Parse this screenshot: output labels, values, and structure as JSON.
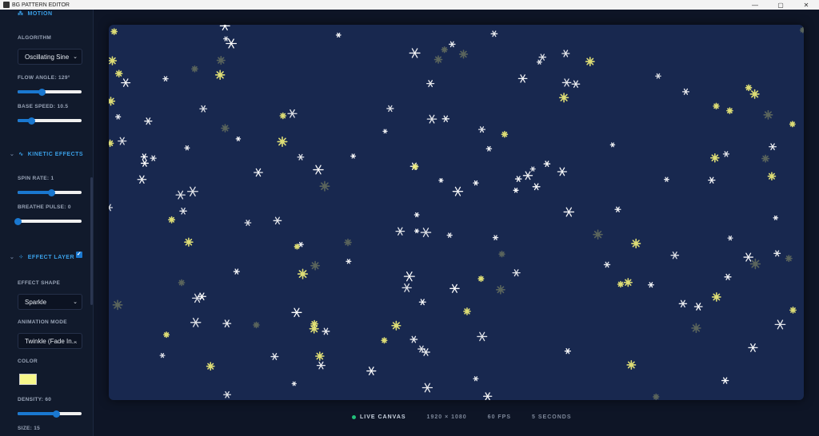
{
  "window": {
    "title": "BG PATTERN EDITOR",
    "controls": [
      "—",
      "▢",
      "✕"
    ]
  },
  "sidebar": {
    "motion": {
      "title": "MOTION",
      "algorithm_label": "ALGORITHM",
      "algorithm_value": "Oscillating Sine",
      "flow_angle_label": "FLOW ANGLE: 129°",
      "flow_angle": 129,
      "flow_angle_fraction": 0.37,
      "base_speed_label": "BASE SPEED: 10.5",
      "base_speed": 10.5,
      "base_speed_fraction": 0.21
    },
    "kinetic": {
      "title": "KINETIC EFFECTS",
      "spin_label": "SPIN RATE: 1",
      "spin_fraction": 0.53,
      "breathe_label": "BREATHE PULSE: 0",
      "breathe_fraction": 0.0
    },
    "effect": {
      "title": "EFFECT LAYER",
      "enabled": true,
      "shape_label": "EFFECT SHAPE",
      "shape_value": "Sparkle",
      "mode_label": "ANIMATION MODE",
      "mode_value": "Twinkle (Fade In...",
      "color_label": "COLOR",
      "color": "#f7f78a",
      "density_label": "DENSITY: 60",
      "density_fraction": 0.6,
      "size_label": "SIZE: 15"
    }
  },
  "status": {
    "live": "LIVE CANVAS",
    "resolution": "1920 × 1080",
    "fps": "60 FPS",
    "duration": "5 SECONDS"
  },
  "colors": {
    "canvas": "#18284f",
    "accent": "#3aa0e8",
    "sparkle": "#f2f07a",
    "snow": "#ffffff"
  }
}
